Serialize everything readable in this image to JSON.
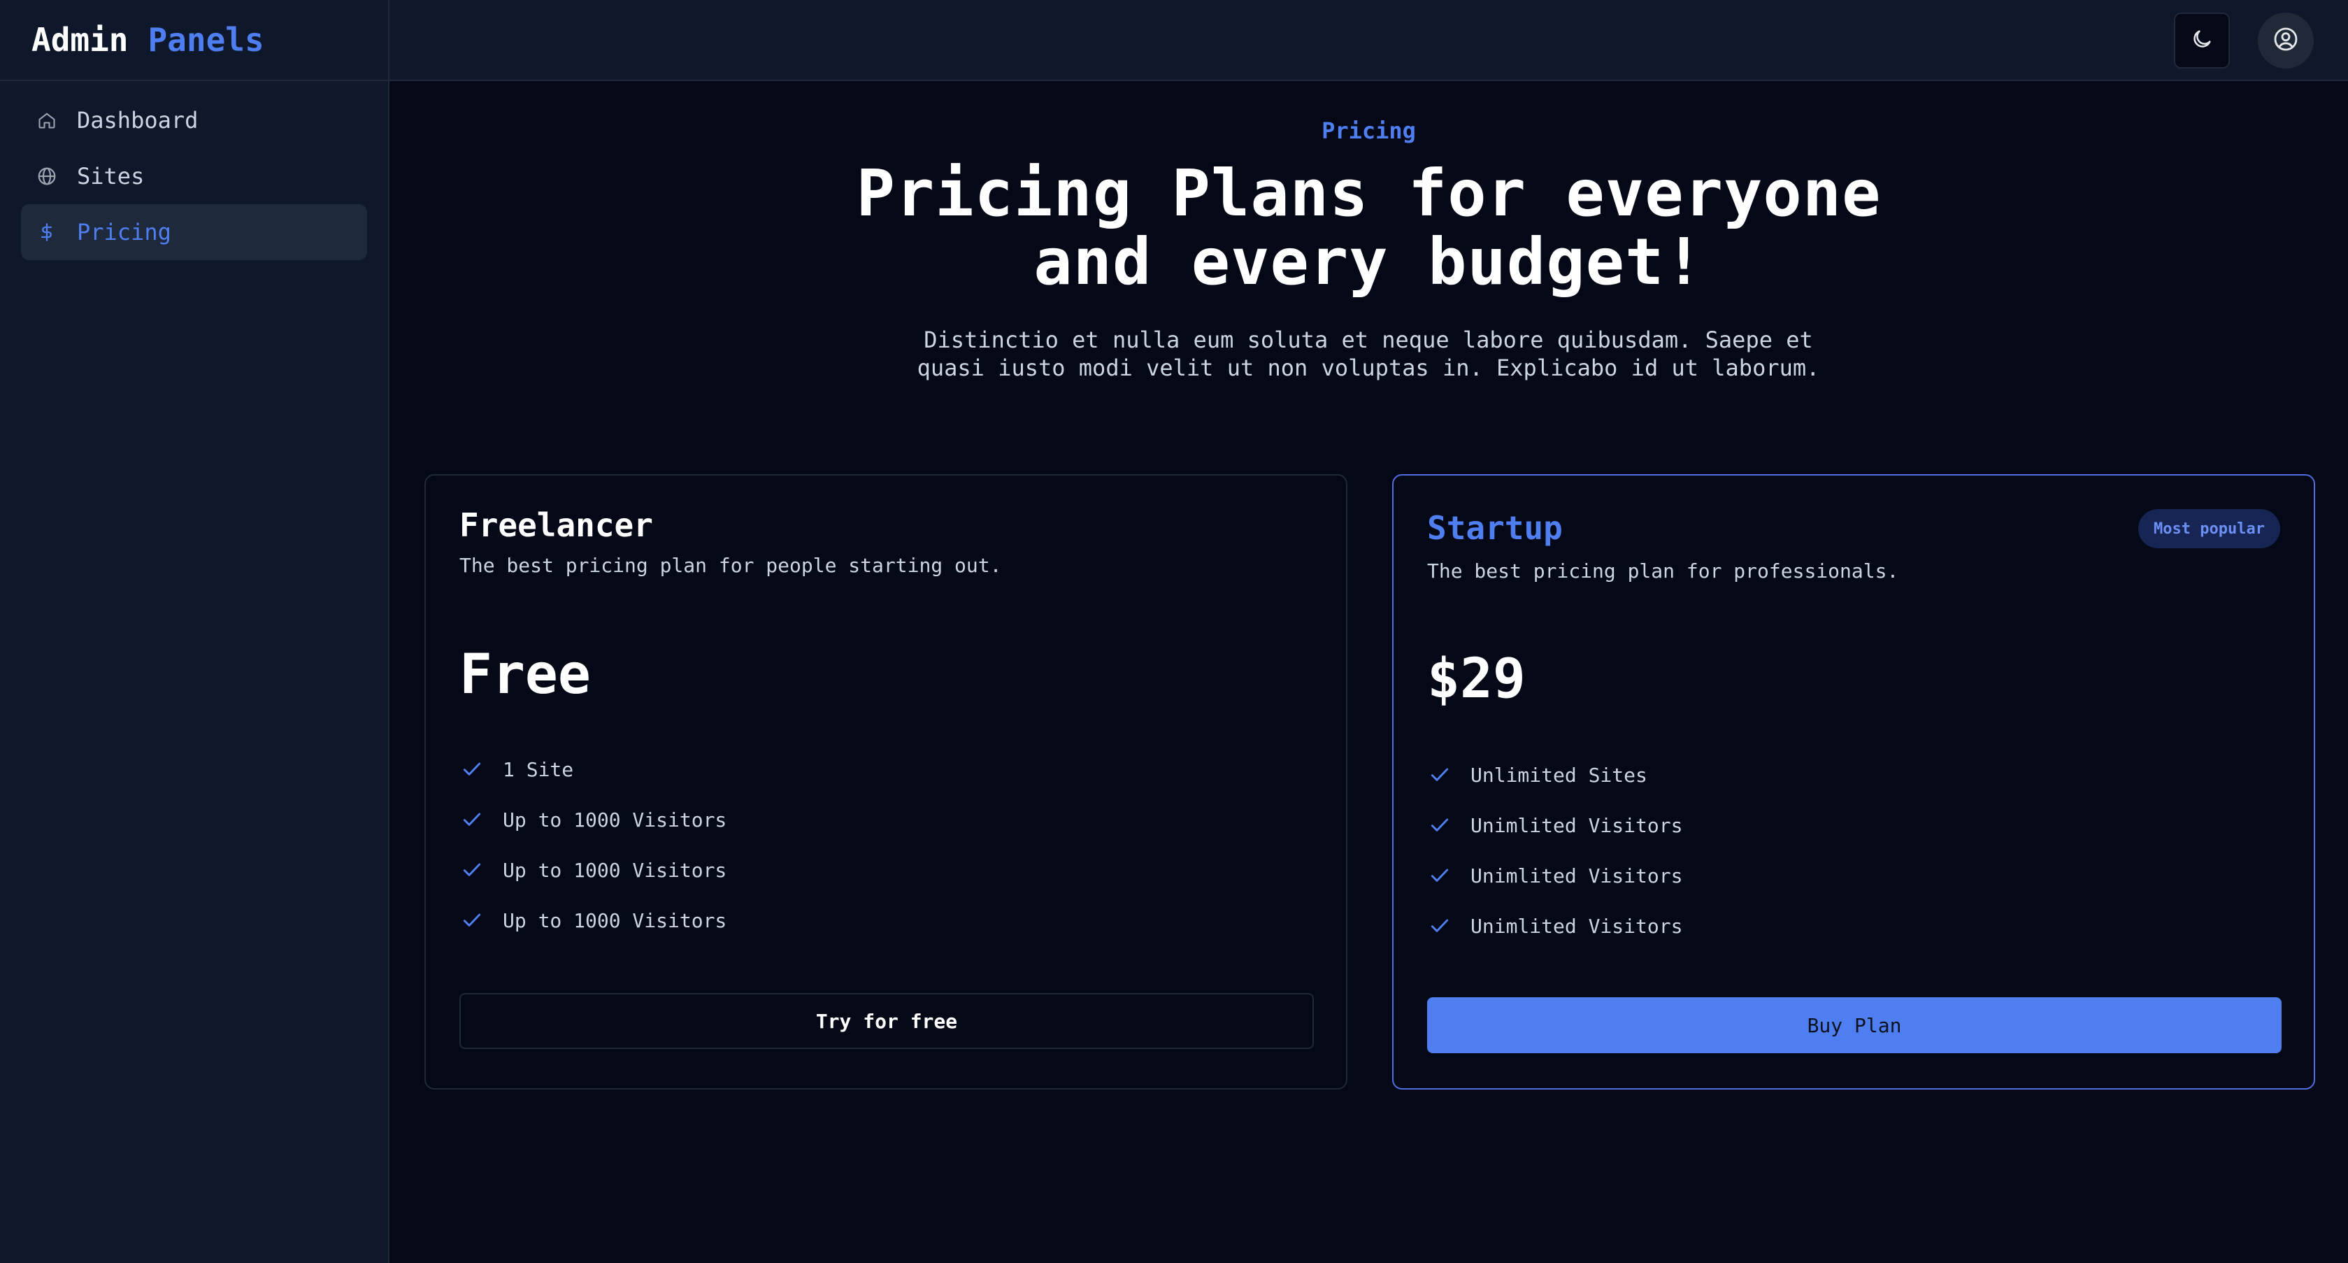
{
  "brand": {
    "part1": "Admin",
    "part2": "Panels"
  },
  "sidebar": {
    "items": [
      {
        "label": "Dashboard",
        "icon": "home-icon",
        "active": false
      },
      {
        "label": "Sites",
        "icon": "globe-icon",
        "active": false
      },
      {
        "label": "Pricing",
        "icon": "dollar-icon",
        "active": true
      }
    ]
  },
  "topbar": {
    "theme_icon": "moon-icon",
    "account_icon": "user-circle-icon"
  },
  "hero": {
    "eyebrow": "Pricing",
    "headline_line1": "Pricing Plans for everyone",
    "headline_line2": "and every budget!",
    "subtext_line1": "Distinctio et nulla eum soluta et neque labore quibusdam. Saepe et",
    "subtext_line2": "quasi iusto modi velit ut non voluptas in. Explicabo id ut laborum."
  },
  "plans": [
    {
      "name": "Freelancer",
      "description": "The best pricing plan for people starting out.",
      "price": "Free",
      "features": [
        "1 Site",
        "Up to 1000 Visitors",
        "Up to 1000 Visitors",
        "Up to 1000 Visitors"
      ],
      "cta": "Try for free"
    },
    {
      "name": "Startup",
      "description": "The best pricing plan for professionals.",
      "badge": "Most popular",
      "price": "$29",
      "features": [
        "Unlimited Sites",
        "Unimlited Visitors",
        "Unimlited Visitors",
        "Unimlited Visitors"
      ],
      "cta": "Buy Plan"
    }
  ],
  "colors": {
    "accent": "#4f7ef0",
    "background": "#050816",
    "sidebar": "#0f172a",
    "border": "#1f2937"
  }
}
